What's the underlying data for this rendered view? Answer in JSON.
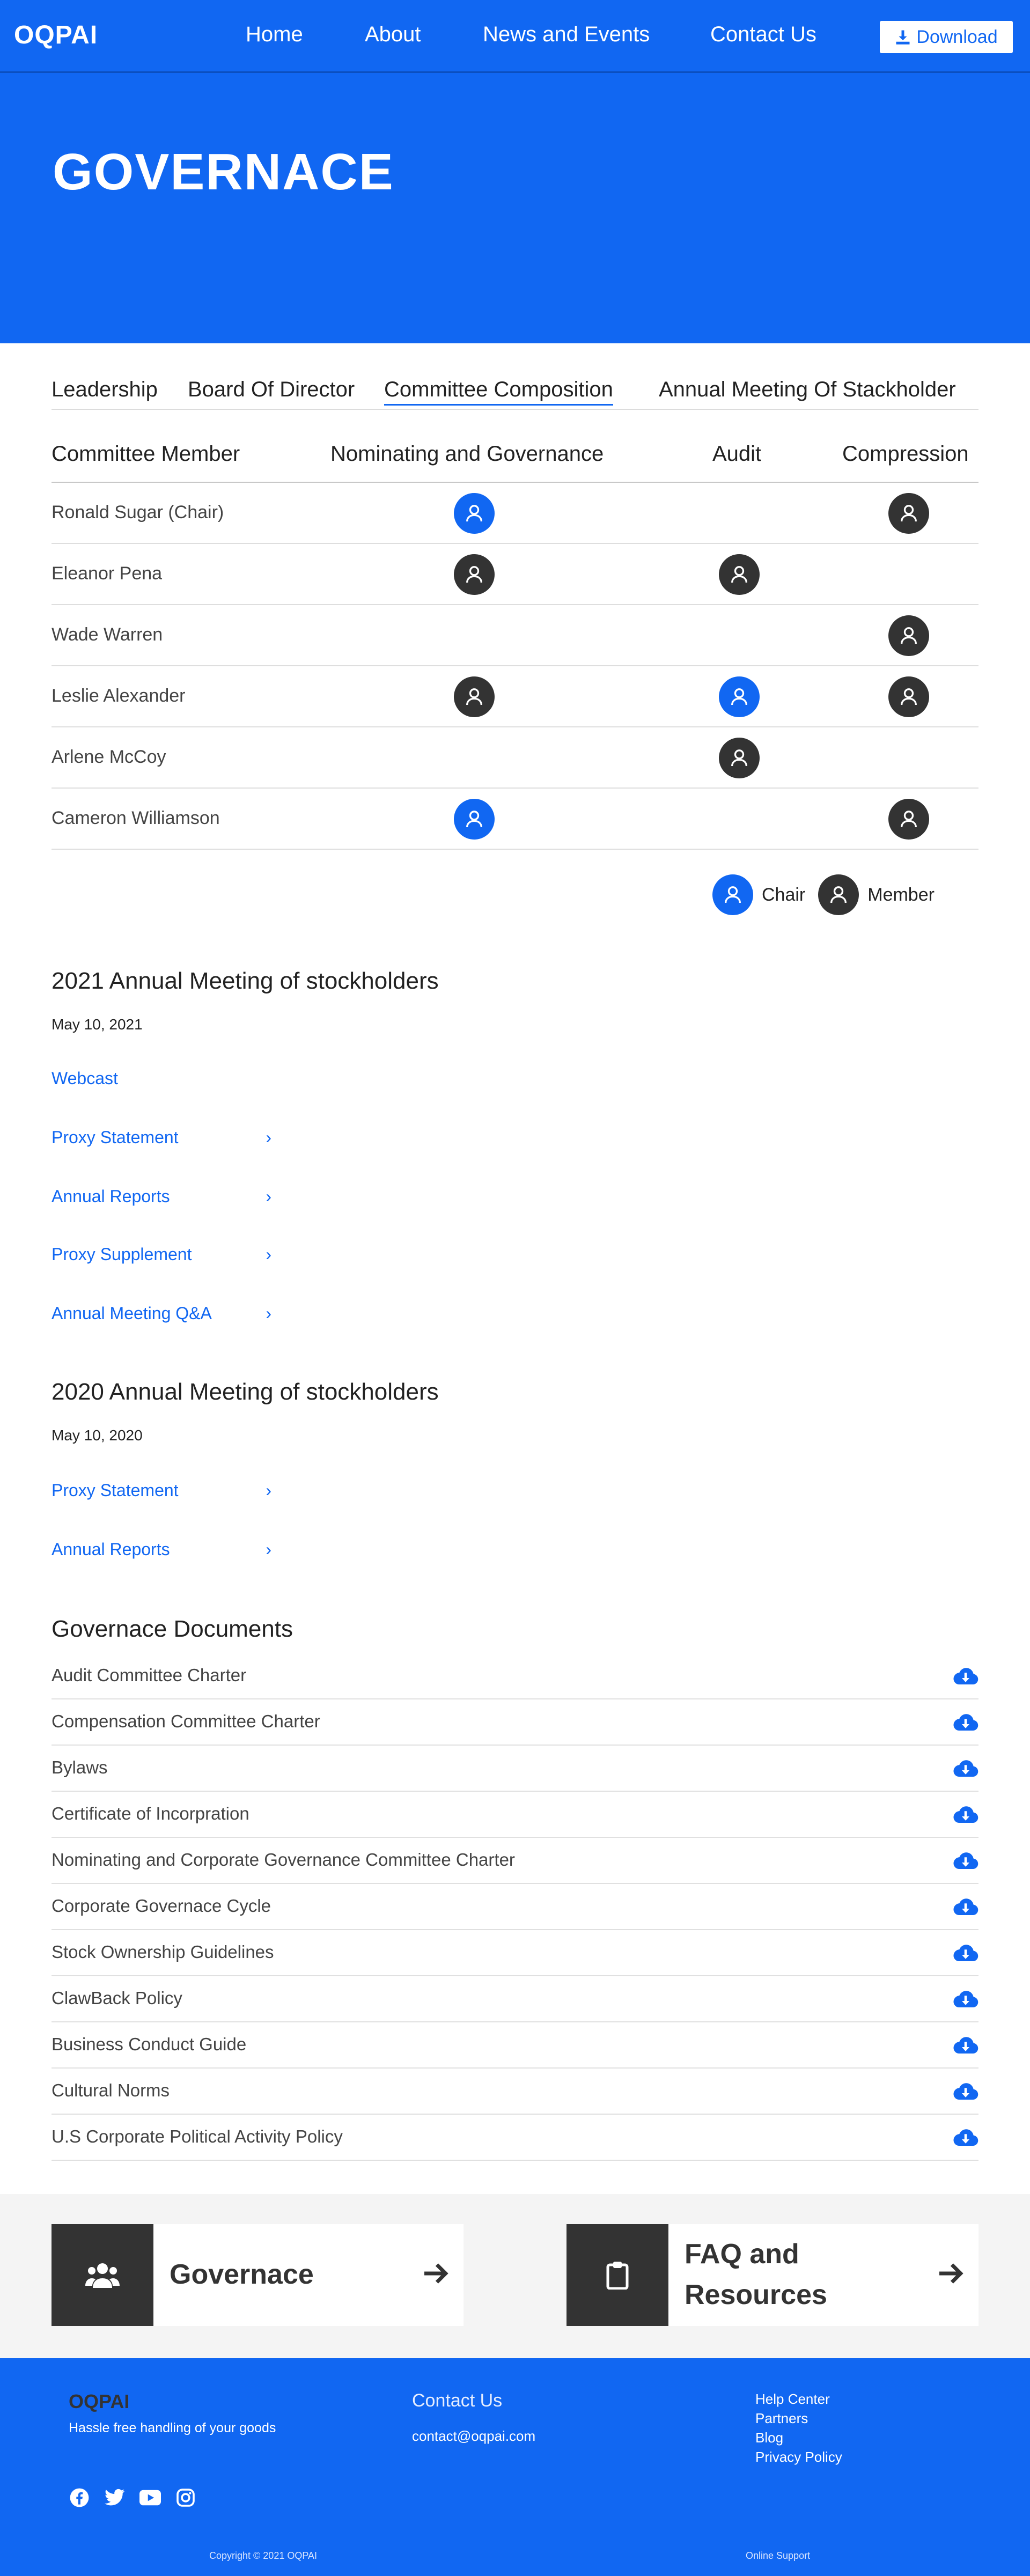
{
  "header": {
    "logo": "OQPAI",
    "nav": [
      "Home",
      "About",
      "News and Events",
      "Contact Us"
    ],
    "download_label": "Download"
  },
  "hero": {
    "title": "GOVERNACE"
  },
  "tabs": [
    {
      "label": "Leadership",
      "active": false
    },
    {
      "label": "Board Of Director",
      "active": false
    },
    {
      "label": "Committee Composition",
      "active": true
    },
    {
      "label": "Annual Meeting Of Stackholder",
      "active": false
    }
  ],
  "committee": {
    "headers": [
      "Committee Member",
      "Nominating and Governance",
      "Audit",
      "Compression"
    ],
    "rows": [
      {
        "name": "Ronald Sugar (Chair)",
        "nominating": "chair",
        "audit": "",
        "compression": "member"
      },
      {
        "name": "Eleanor Pena",
        "nominating": "member",
        "audit": "member",
        "compression": ""
      },
      {
        "name": "Wade Warren",
        "nominating": "",
        "audit": "",
        "compression": "member"
      },
      {
        "name": "Leslie Alexander",
        "nominating": "member",
        "audit": "chair",
        "compression": "member"
      },
      {
        "name": "Arlene McCoy",
        "nominating": "",
        "audit": "member",
        "compression": ""
      },
      {
        "name": "Cameron Williamson",
        "nominating": "chair",
        "audit": "",
        "compression": "member"
      }
    ],
    "legend": {
      "chair": "Chair",
      "member": "Member"
    }
  },
  "meetings": [
    {
      "title": "2021 Annual Meeting of stockholders",
      "date": "May 10, 2021",
      "links": [
        {
          "label": "Webcast",
          "chevron": false
        },
        {
          "label": "Proxy Statement",
          "chevron": true
        },
        {
          "label": "Annual Reports",
          "chevron": true
        },
        {
          "label": "Proxy Supplement",
          "chevron": true
        },
        {
          "label": "Annual Meeting Q&A",
          "chevron": true
        }
      ]
    },
    {
      "title": "2020 Annual Meeting of stockholders",
      "date": "May 10, 2020",
      "links": [
        {
          "label": "Proxy Statement",
          "chevron": true
        },
        {
          "label": "Annual Reports",
          "chevron": true
        }
      ]
    }
  ],
  "documents": {
    "title": "Governace Documents",
    "items": [
      "Audit Committee Charter",
      "Compensation Committee Charter",
      "Bylaws",
      "Certificate of Incorpration",
      "Nominating and Corporate Governance Committee Charter",
      "Corporate Governace Cycle",
      "Stock Ownership Guidelines",
      "ClawBack Policy",
      "Business Conduct Guide",
      "Cultural Norms",
      "U.S Corporate Political Activity Policy"
    ]
  },
  "cards": [
    {
      "title_line1": "Governace",
      "title_line2": "",
      "icon": "users-icon"
    },
    {
      "title_line1": "FAQ and",
      "title_line2": "Resources",
      "icon": "clipboard-icon"
    }
  ],
  "footer": {
    "logo": "OQPAI",
    "tagline": "Hassle free handling of your goods",
    "contact_title": "Contact Us",
    "email": "contact@oqpai.com",
    "links": [
      "Help Center",
      "Partners",
      "Blog",
      "Privacy Policy"
    ],
    "social": [
      "facebook-icon",
      "twitter-icon",
      "youtube-icon",
      "instagram-icon"
    ],
    "copyright": "Copyright © 2021 OQPAI",
    "online_support": "Online Support"
  },
  "colors": {
    "brand": "#1167f2",
    "chair": "#1167f2",
    "member": "#333333",
    "card_icon_bg": "#333333"
  }
}
